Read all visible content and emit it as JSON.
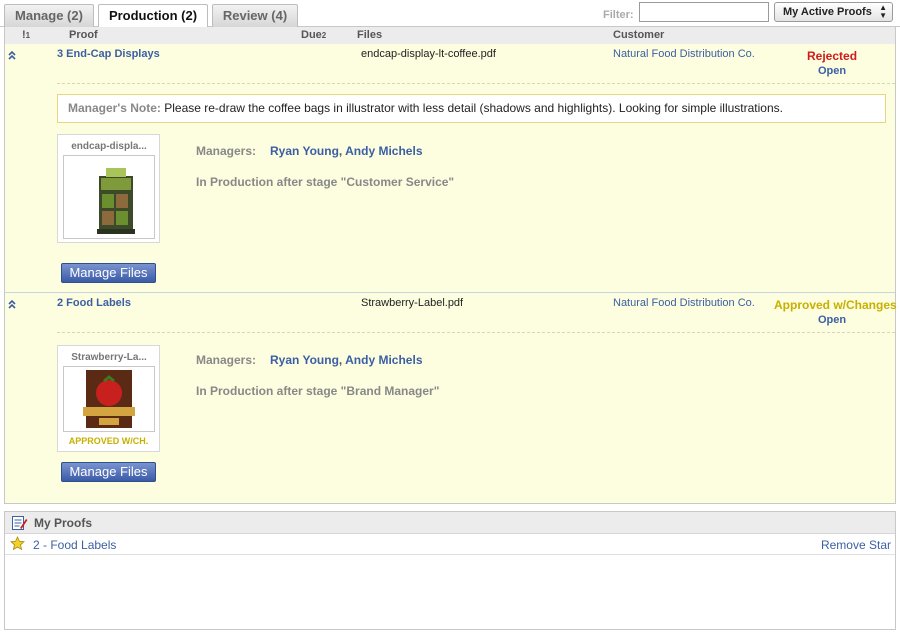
{
  "tabs": [
    {
      "label": "Manage (2)",
      "active": false
    },
    {
      "label": "Production (2)",
      "active": true
    },
    {
      "label": "Review (4)",
      "active": false
    }
  ],
  "filter": {
    "label": "Filter:",
    "value": ""
  },
  "view_select": {
    "selected": "My Active Proofs"
  },
  "columns": {
    "priority": "!",
    "priority_sort": "1",
    "proof": "Proof",
    "due": "Due",
    "due_sort": "2",
    "files": "Files",
    "customer": "Customer"
  },
  "rows": [
    {
      "proof": "3  End-Cap Displays",
      "file": "endcap-display-lt-coffee.pdf",
      "customer": "Natural Food Distribution Co.",
      "status": "Rejected",
      "status_color": "#d11a1a",
      "open": "Open",
      "note_label": "Manager's Note:",
      "note_text": "Please re-draw the coffee bags in illustrator with less detail (shadows and highlights). Looking for simple illustrations.",
      "thumb_name": "endcap-displa...",
      "thumb_tag": "",
      "managers_label": "Managers:",
      "managers": [
        "Ryan Young",
        "Andy Michels"
      ],
      "manager_sep": ",",
      "stage": "In Production after stage \"Customer Service\"",
      "button": "Manage Files"
    },
    {
      "proof": "2  Food Labels",
      "file": "Strawberry-Label.pdf",
      "customer": "Natural Food Distribution Co.",
      "status": "Approved w/Changes",
      "status_color": "#c7b000",
      "open": "Open",
      "thumb_name": "Strawberry-La...",
      "thumb_tag": "APPROVED W/CH.",
      "managers_label": "Managers:",
      "managers": [
        "Ryan Young",
        "Andy Michels"
      ],
      "manager_sep": ",",
      "stage": "In Production after stage \"Brand Manager\"",
      "button": "Manage Files"
    }
  ],
  "my_proofs": {
    "title": "My Proofs",
    "items": [
      {
        "label": "2 - Food Labels",
        "action": "Remove Star"
      }
    ]
  },
  "icons": {
    "collapse": "double-chevron-up-icon",
    "star": "star-icon",
    "my_proofs": "notepad-pencil-icon",
    "select_arrows": "up-down-arrows-icon"
  }
}
